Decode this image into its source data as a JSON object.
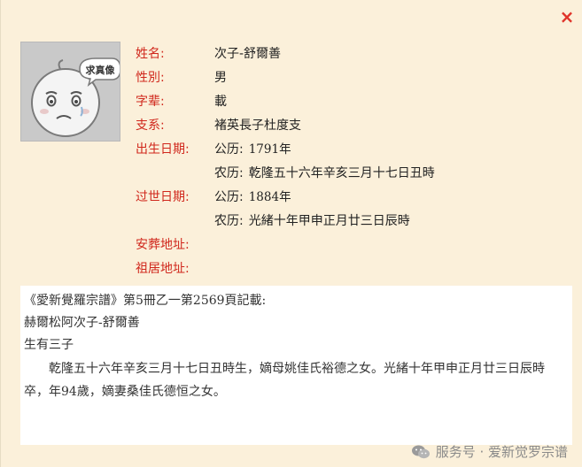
{
  "close_label": "×",
  "avatar_text": "求真像",
  "fields": [
    {
      "label": "姓名:",
      "value": "次子-舒爾善"
    },
    {
      "label": "性別:",
      "value": "男"
    },
    {
      "label": "字辈:",
      "value": "載"
    },
    {
      "label": "支系:",
      "value": "褚英長子杜度支"
    },
    {
      "label": "出生日期:",
      "calendar": "公历:",
      "date": "1791年"
    },
    {
      "label": "",
      "calendar": "农历:",
      "date": "乾隆五十六年辛亥三月十七日丑時"
    },
    {
      "label": "过世日期:",
      "calendar": "公历:",
      "date": "1884年"
    },
    {
      "label": "",
      "calendar": "农历:",
      "date": "光緒十年甲申正月廿三日辰時"
    },
    {
      "label": "安葬地址:",
      "value": ""
    },
    {
      "label": "祖居地址:",
      "value": ""
    }
  ],
  "record": {
    "source_line": "《愛新覺羅宗譜》第5冊乙一第2569頁記載:",
    "name_line": "赫爾松阿次子-舒爾善",
    "children_line": "生有三子",
    "body": "乾隆五十六年辛亥三月十七日丑時生，嫡母姚佳氏裕德之女。光緒十年甲申正月廿三日辰時卒，年94歲，嫡妻桑佳氏德恒之女。"
  },
  "watermark": {
    "text": "服务号 · 爱新觉罗宗谱",
    "icon": "wechat-icon"
  },
  "colors": {
    "panel_bg": "#fbf0da",
    "label_red": "#d0271c",
    "close_red": "#e0342a"
  }
}
